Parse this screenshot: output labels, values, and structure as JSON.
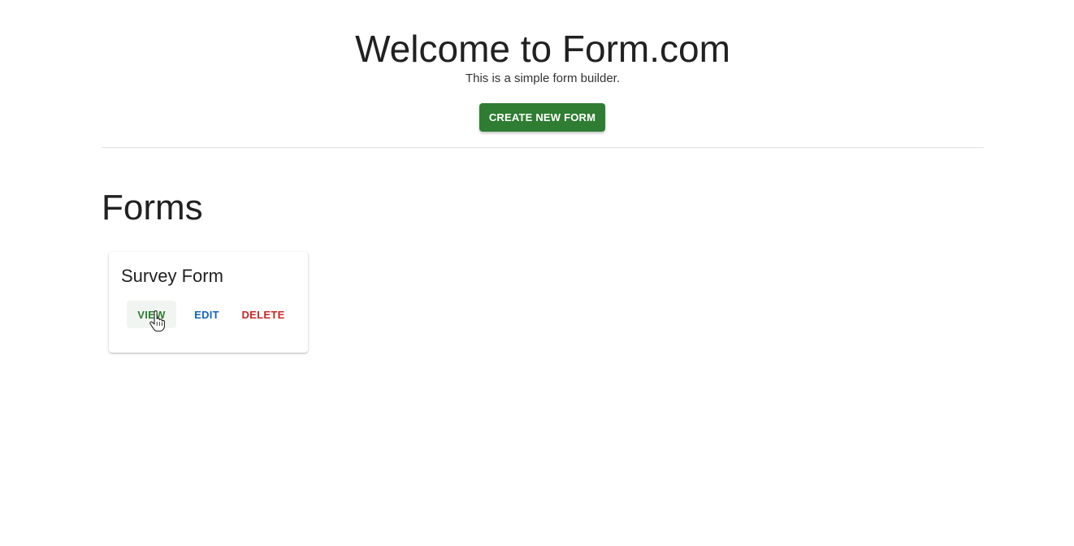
{
  "header": {
    "title": "Welcome to Form.com",
    "subtitle": "This is a simple form builder.",
    "create_button_label": "CREATE NEW FORM"
  },
  "forms_section": {
    "title": "Forms",
    "forms": [
      {
        "name": "Survey Form",
        "actions": {
          "view_label": "VIEW",
          "edit_label": "EDIT",
          "delete_label": "DELETE"
        }
      }
    ]
  },
  "colors": {
    "primary_green": "#2e7d32",
    "edit_blue": "#1565c0",
    "delete_red": "#c62828"
  },
  "icons": {
    "pointer": "hand-pointer-icon"
  }
}
